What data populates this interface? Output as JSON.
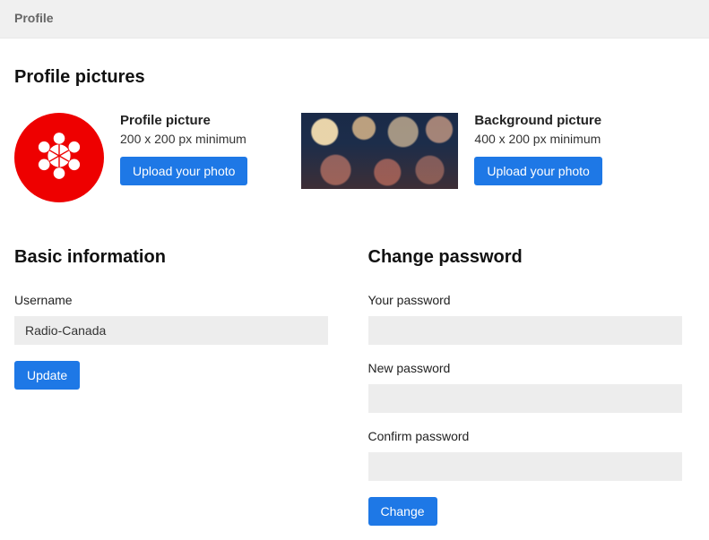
{
  "tab": {
    "label": "Profile"
  },
  "pictures": {
    "heading": "Profile pictures",
    "profile": {
      "title": "Profile picture",
      "hint": "200 x 200 px minimum",
      "button": "Upload your photo"
    },
    "background": {
      "title": "Background picture",
      "hint": "400 x 200 px minimum",
      "button": "Upload your photo"
    }
  },
  "basic": {
    "heading": "Basic information",
    "username_label": "Username",
    "username_value": "Radio-Canada",
    "update_button": "Update"
  },
  "password": {
    "heading": "Change password",
    "current_label": "Your password",
    "new_label": "New password",
    "confirm_label": "Confirm password",
    "change_button": "Change"
  }
}
